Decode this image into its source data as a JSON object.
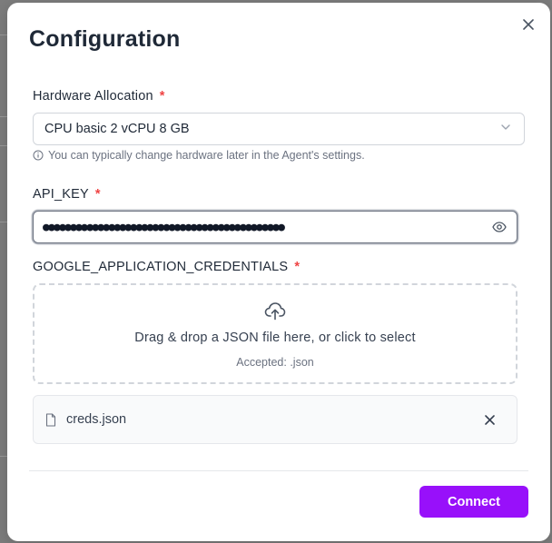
{
  "modal": {
    "title": "Configuration"
  },
  "hardware": {
    "label": "Hardware Allocation",
    "required_mark": "*",
    "selected": "CPU basic 2 vCPU 8 GB",
    "hint": "You can typically change hardware later in the Agent's settings."
  },
  "api_key": {
    "label": "API_KEY",
    "required_mark": "*",
    "value": "●●●●●●●●●●●●●●●●●●●●●●●●●●●●●●●●●●●●●●●●●●●●"
  },
  "credentials": {
    "label": "GOOGLE_APPLICATION_CREDENTIALS",
    "required_mark": "*",
    "dropzone_text": "Drag & drop a JSON file here, or click to select",
    "accepted_text": "Accepted: .json",
    "file_name": "creds.json"
  },
  "footer": {
    "connect_label": "Connect"
  },
  "colors": {
    "accent": "#9810fa",
    "required": "#ef4444"
  },
  "icons": [
    "close-icon",
    "chevron-down-icon",
    "info-icon",
    "eye-icon",
    "upload-cloud-icon",
    "file-icon",
    "remove-icon"
  ]
}
